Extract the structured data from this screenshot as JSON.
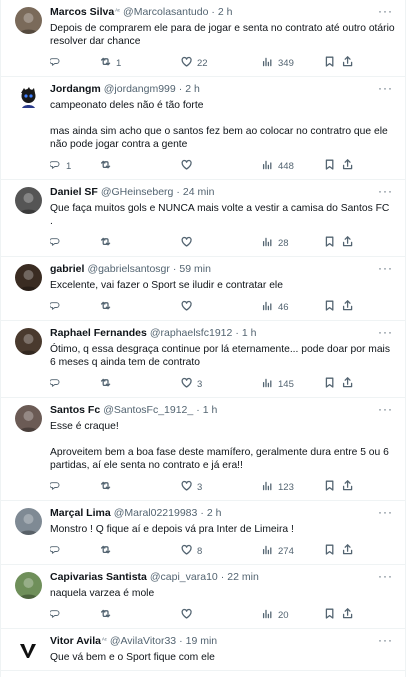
{
  "tweets": [
    {
      "name": "Marcos Silva",
      "badge": "ᴬᶜ",
      "handle": "@Marcolasantudo",
      "time": "2 h",
      "lines": [
        "Depois de comprarem ele para de jogar e senta no contrato até outro otário resolver dar chance"
      ],
      "reply": "",
      "retweet": "1",
      "like": "22",
      "views": "349",
      "avatar_color": "#7a6a5a"
    },
    {
      "name": "Jordangm",
      "badge": "",
      "handle": "@jordangm999",
      "time": "2 h",
      "lines": [
        "campeonato deles não é tão forte",
        "mas ainda sim acho que o santos fez bem ao colocar no contratro que ele não pode jogar contra a gente"
      ],
      "reply": "1",
      "retweet": "",
      "like": "",
      "views": "448",
      "avatar_color": "#2a3a8a"
    },
    {
      "name": "Daniel SF",
      "badge": "",
      "handle": "@GHeinseberg",
      "time": "24 min",
      "lines": [
        "Que faça muitos gols e NUNCA mais volte a vestir a camisa do Santos FC ."
      ],
      "reply": "",
      "retweet": "",
      "like": "",
      "views": "28",
      "avatar_color": "#555555"
    },
    {
      "name": "gabriel",
      "badge": "",
      "handle": "@gabrielsantosgr",
      "time": "59 min",
      "lines": [
        "Excelente, vai fazer o Sport se iludir e contratar ele"
      ],
      "reply": "",
      "retweet": "",
      "like": "",
      "views": "46",
      "avatar_color": "#3a2c22"
    },
    {
      "name": "Raphael Fernandes",
      "badge": "",
      "handle": "@raphaelsfc1912",
      "time": "1 h",
      "lines": [
        "Ótimo, q essa desgraça continue por lá eternamente... pode doar por mais 6 meses q ainda tem de contrato"
      ],
      "reply": "",
      "retweet": "",
      "like": "3",
      "views": "145",
      "avatar_color": "#4a3a2e"
    },
    {
      "name": "Santos Fc",
      "badge": "",
      "handle": "@SantosFc_1912_",
      "time": "1 h",
      "lines": [
        "Esse é craque!",
        "Aproveitem bem a boa fase deste mamífero, geralmente dura entre 5 ou 6 partidas, aí ele senta no contrato e já era!!"
      ],
      "reply": "",
      "retweet": "",
      "like": "3",
      "views": "123",
      "avatar_color": "#6b5b55"
    },
    {
      "name": "Marçal Lima",
      "badge": "",
      "handle": "@Maral02219983",
      "time": "2 h",
      "lines": [
        "Monstro ! Q fique aí e depois vá pra Inter de Limeira !"
      ],
      "reply": "",
      "retweet": "",
      "like": "8",
      "views": "274",
      "avatar_color": "#7f8a94"
    },
    {
      "name": "Capivarias Santista",
      "badge": "",
      "handle": "@capi_vara10",
      "time": "22 min",
      "lines": [
        "naquela varzea é mole"
      ],
      "reply": "",
      "retweet": "",
      "like": "",
      "views": "20",
      "avatar_color": "#6f8f5a"
    },
    {
      "name": "Vitor Avila",
      "badge": "ᴬᶜ",
      "handle": "@AvilaVitor33",
      "time": "19 min",
      "lines": [
        "Que vá bem e o Sport fique com ele"
      ],
      "reply": "",
      "retweet": "",
      "like": "",
      "views": "",
      "avatar_color": "#111111"
    }
  ],
  "labels": {
    "dot": "·",
    "more": "···"
  }
}
